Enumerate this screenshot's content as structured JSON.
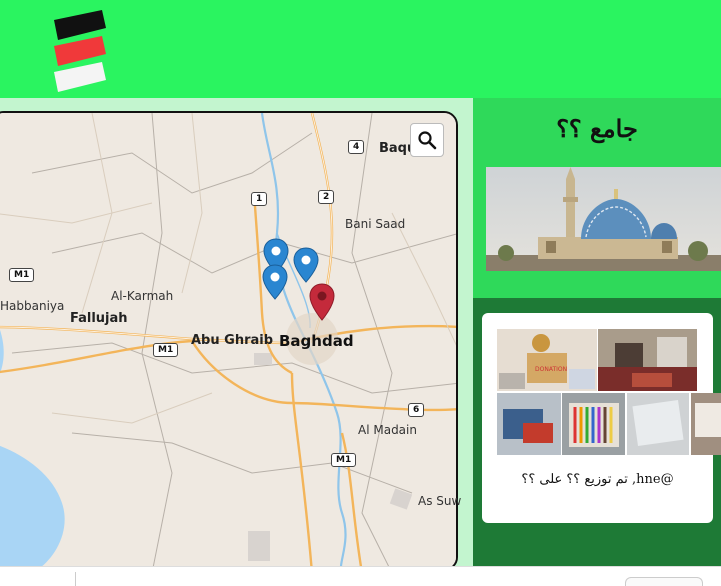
{
  "sidebar": {
    "title": "جامع ؟؟",
    "caption": "تم توزيع ؟؟ على ؟؟ ,hne@",
    "gallery_label": "DONATION"
  },
  "map": {
    "labels": {
      "baquba": "Baqu",
      "bani_saad": "Bani Saad",
      "habbaniya": "Habbaniya",
      "al_karmah": "Al-Karmah",
      "fallujah": "Fallujah",
      "abu_ghraib": "Abu Ghraib",
      "baghdad": "Baghdad",
      "al_madain": "Al Madain",
      "as_suw": "As Suw"
    },
    "shields": {
      "r4": "4",
      "r1": "1",
      "r2": "2",
      "m1_west": "M1",
      "m1_center": "M1",
      "r6": "6",
      "m1_south": "M1"
    },
    "colors": {
      "blue_marker": "#2a86d1",
      "red_marker": "#c42a3b",
      "water": "#a9d5f5",
      "road_major": "#f3b55a"
    }
  },
  "colors": {
    "header": "#2af460",
    "map_strip": "#c3f5cf",
    "right_top": "#2fd95a",
    "right_bottom": "#1e7a36"
  }
}
